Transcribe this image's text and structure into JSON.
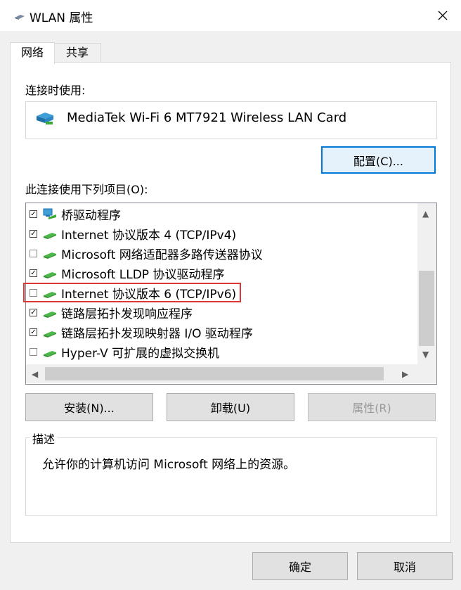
{
  "window": {
    "title": "WLAN 属性",
    "close_symbol": "✕"
  },
  "tabs": [
    {
      "label": "网络"
    },
    {
      "label": "共享"
    }
  ],
  "connect_using": {
    "label": "连接时使用:",
    "adapter": "MediaTek Wi-Fi 6 MT7921 Wireless LAN Card",
    "configure_button": "配置(C)..."
  },
  "items_label": "此连接使用下列项目(O):",
  "items": [
    {
      "label": "桥驱动程序",
      "checked": true
    },
    {
      "label": "Internet 协议版本 4 (TCP/IPv4)",
      "checked": true
    },
    {
      "label": "Microsoft 网络适配器多路传送器协议",
      "checked": false
    },
    {
      "label": "Microsoft LLDP 协议驱动程序",
      "checked": true
    },
    {
      "label": "Internet 协议版本 6 (TCP/IPv6)",
      "checked": false
    },
    {
      "label": "链路层拓扑发现响应程序",
      "checked": true
    },
    {
      "label": "链路层拓扑发现映射器 I/O 驱动程序",
      "checked": true
    },
    {
      "label": "Hyper-V 可扩展的虚拟交换机",
      "checked": false
    }
  ],
  "action_buttons": {
    "install": "安装(N)...",
    "uninstall": "卸载(U)",
    "properties": "属性(R)"
  },
  "description": {
    "legend": "描述",
    "text": "允许你的计算机访问 Microsoft 网络上的资源。"
  },
  "footer": {
    "ok": "确定",
    "cancel": "取消"
  }
}
